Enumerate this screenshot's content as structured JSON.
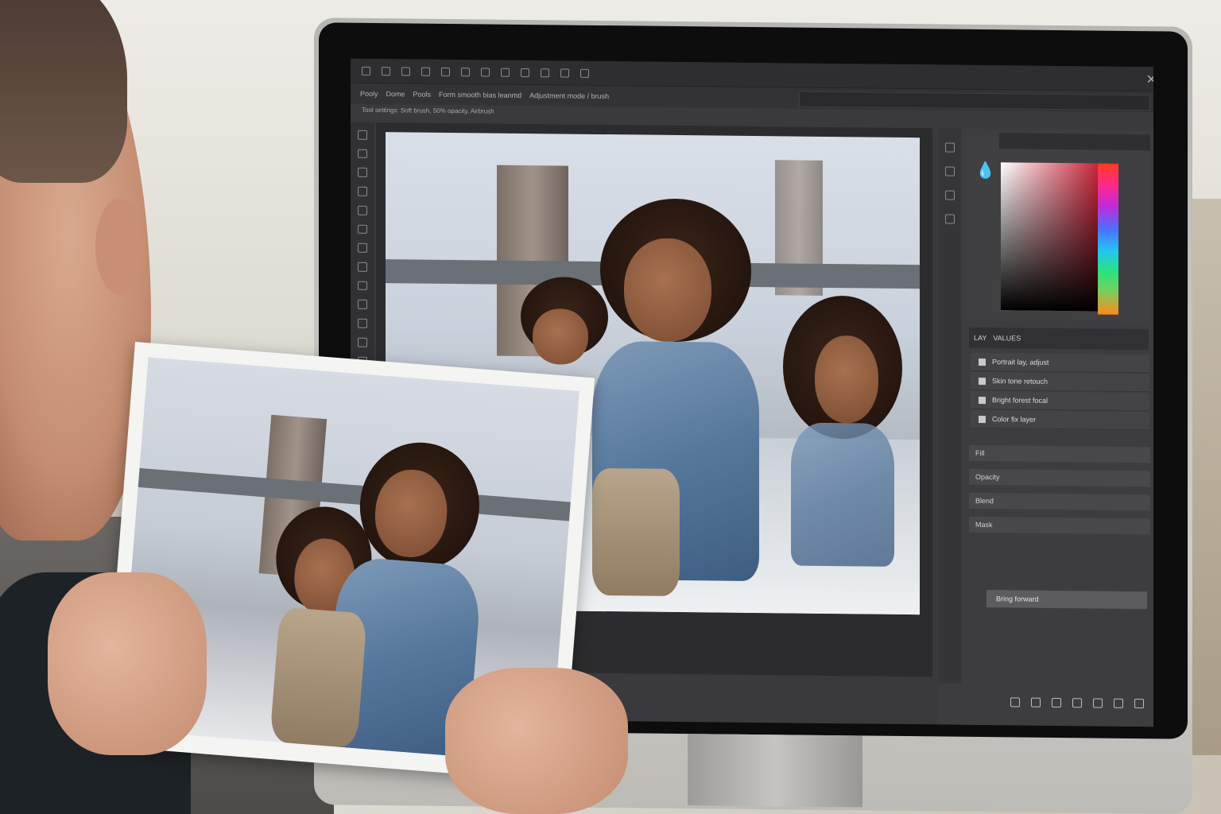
{
  "app": {
    "menu_icons": [
      "home-icon",
      "back-icon",
      "move-icon",
      "brush-icon",
      "eraser-icon",
      "text-icon",
      "undo-icon",
      "redo-icon",
      "zoom-icon",
      "hand-icon",
      "crop-icon",
      "settings-icon"
    ],
    "options": [
      "Pooly",
      "Dome",
      "Pools",
      "Form smooth bias leanmd",
      "Adjustment mode / brush"
    ],
    "breadcrumb": "Tool settings: Soft brush, 50% opacity, Airbrush",
    "close_glyph": "✕"
  },
  "color_panel": {
    "eyedrop_glyph": "💧",
    "base_hue": "#c8263a"
  },
  "layers": {
    "tabs": [
      "LAY",
      "VALUES"
    ],
    "rows": [
      "Portrait lay, adjust",
      "Skin tone retouch",
      "Bright forest focal",
      "Color fix layer"
    ]
  },
  "properties": {
    "rows": [
      "Fill",
      "Opacity",
      "Blend",
      "Mask"
    ],
    "action_label": "Bring forward"
  },
  "colors": {
    "ui_dark": "#2e2e30",
    "panel": "#3d3d40",
    "denim": "#56779c",
    "bridge": "#7c6f66"
  }
}
